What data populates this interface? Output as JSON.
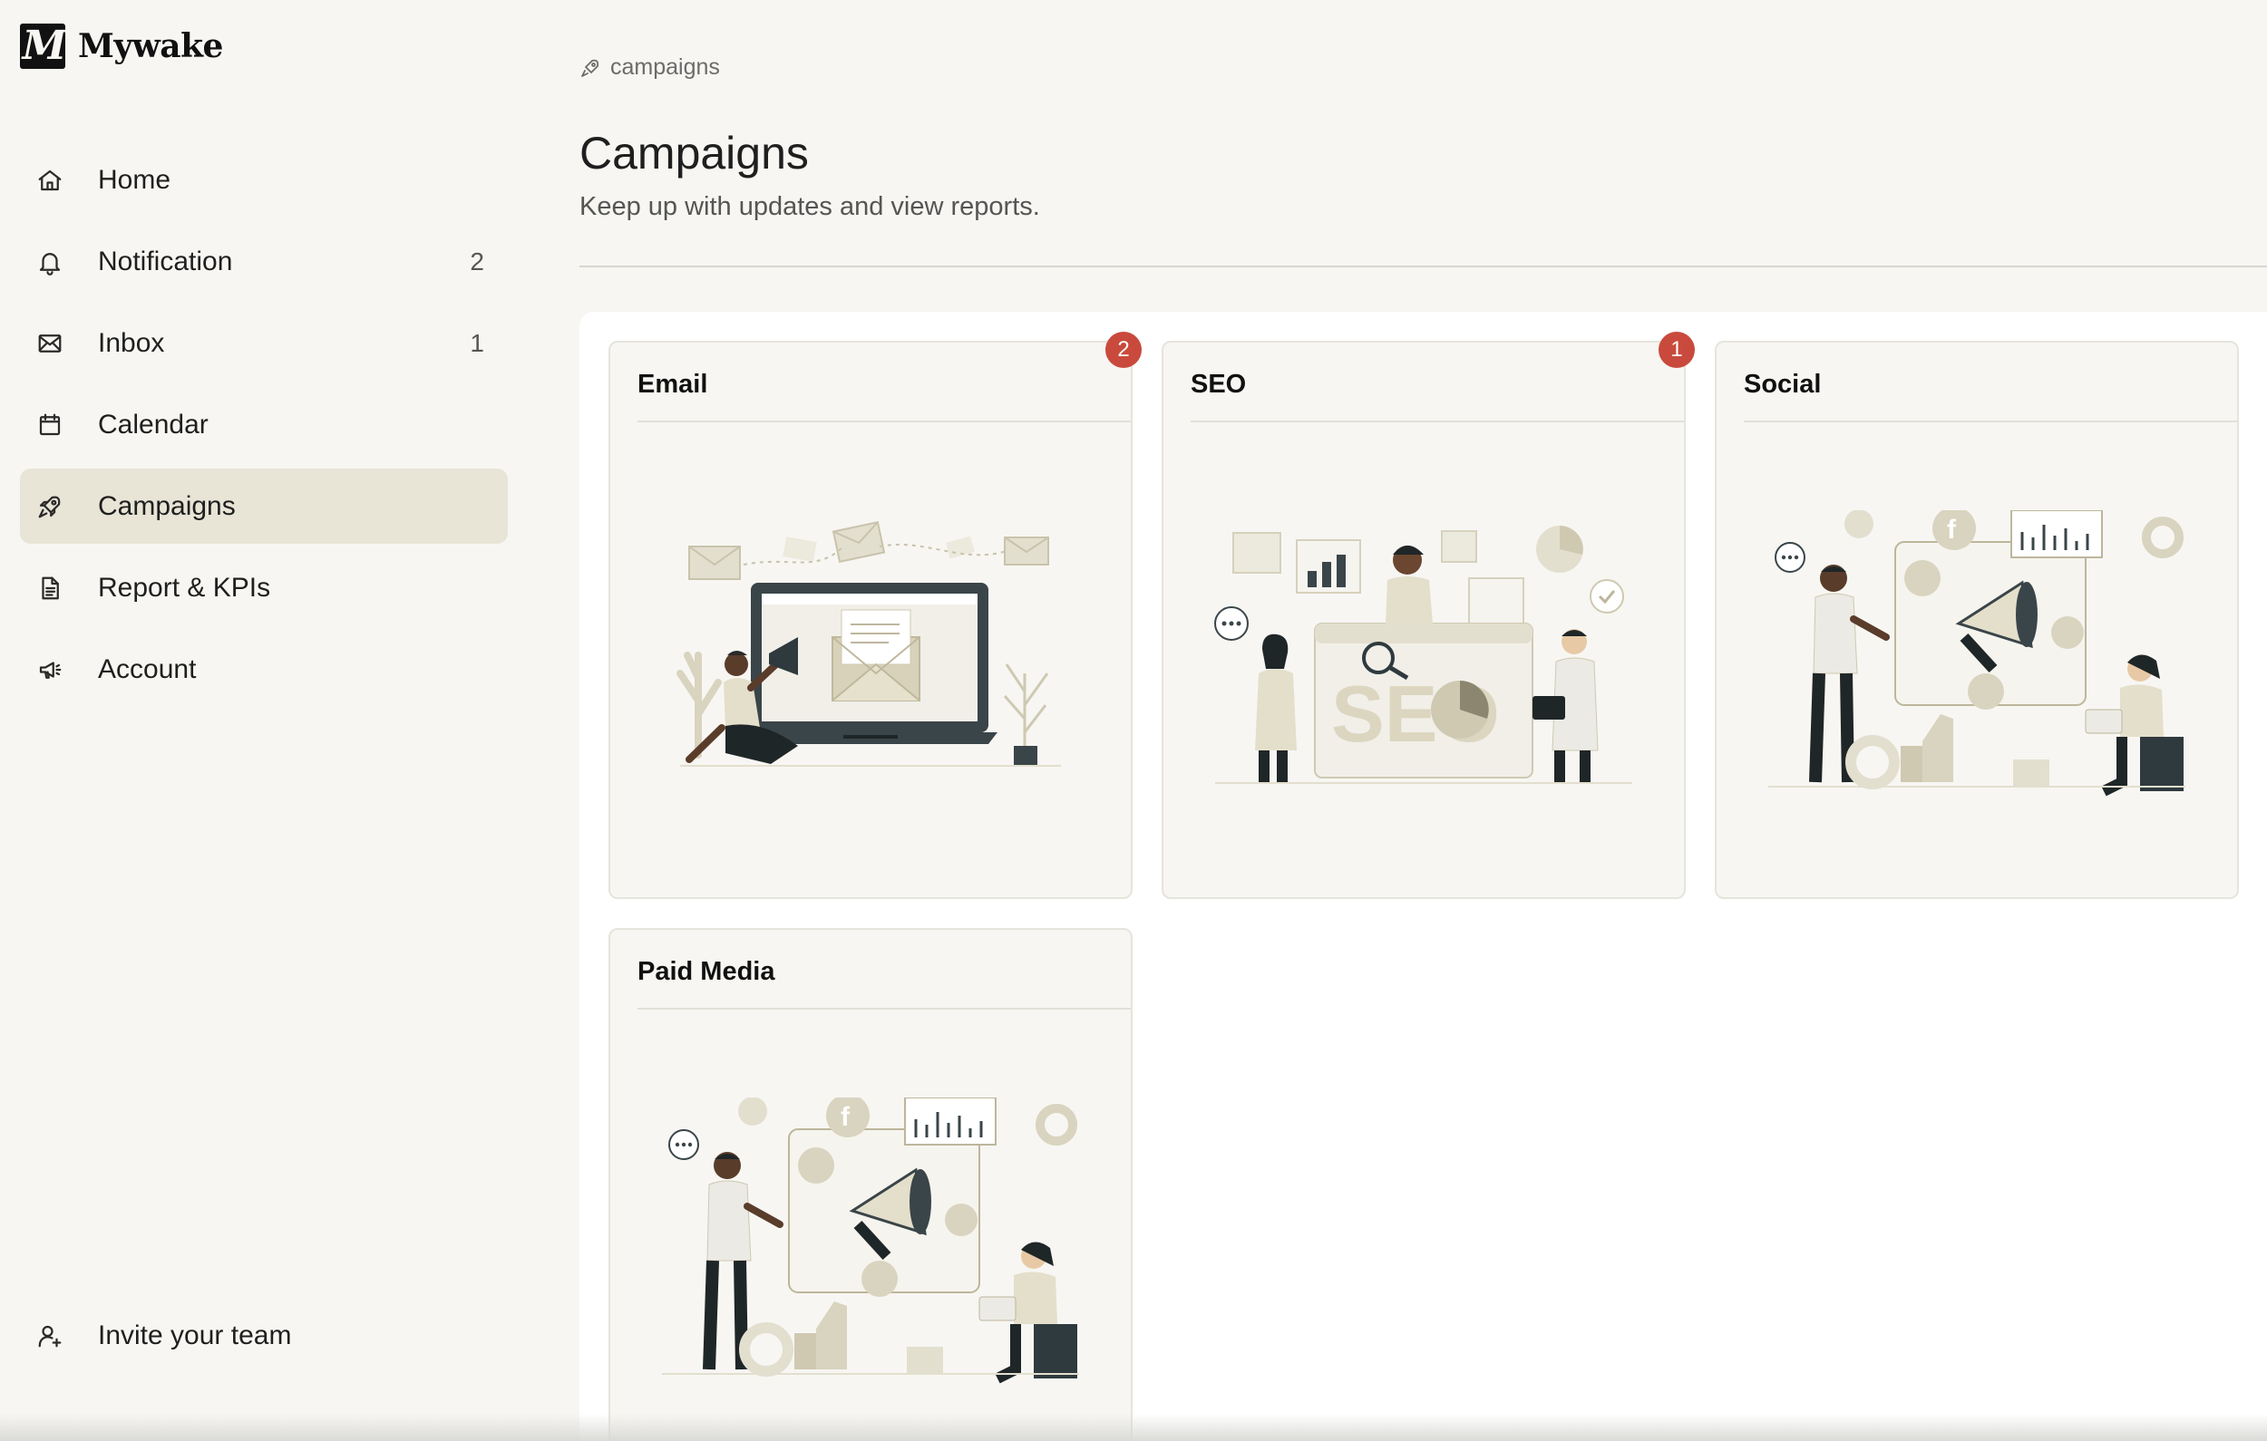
{
  "app": {
    "name": "Mywake",
    "logo_letter": "M"
  },
  "sidebar": {
    "items": [
      {
        "label": "Home",
        "icon": "home-icon",
        "count": ""
      },
      {
        "label": "Notification",
        "icon": "bell-icon",
        "count": "2"
      },
      {
        "label": "Inbox",
        "icon": "mail-icon",
        "count": "1"
      },
      {
        "label": "Calendar",
        "icon": "calendar-icon",
        "count": ""
      },
      {
        "label": "Campaigns",
        "icon": "rocket-icon",
        "count": "",
        "active": true
      },
      {
        "label": "Report & KPIs",
        "icon": "document-icon",
        "count": ""
      },
      {
        "label": "Account",
        "icon": "megaphone-icon",
        "count": ""
      }
    ],
    "invite_label": "Invite your team"
  },
  "breadcrumb": {
    "label": "campaigns",
    "icon": "rocket-icon"
  },
  "page": {
    "title": "Campaigns",
    "subtitle": "Keep up with updates and view reports."
  },
  "cards": [
    {
      "title": "Email",
      "badge": "2",
      "illustration": "email-marketing-illustration"
    },
    {
      "title": "SEO",
      "badge": "1",
      "illustration": "seo-illustration"
    },
    {
      "title": "Social",
      "badge": "",
      "illustration": "social-media-illustration"
    },
    {
      "title": "Paid Media",
      "badge": "",
      "illustration": "paid-media-illustration"
    }
  ],
  "colors": {
    "background": "#f7f6f2",
    "active_nav": "#e8e4d6",
    "badge": "#c94a3c",
    "illustration_beige": "#d9d4bf",
    "illustration_dark": "#2f3a3e"
  }
}
